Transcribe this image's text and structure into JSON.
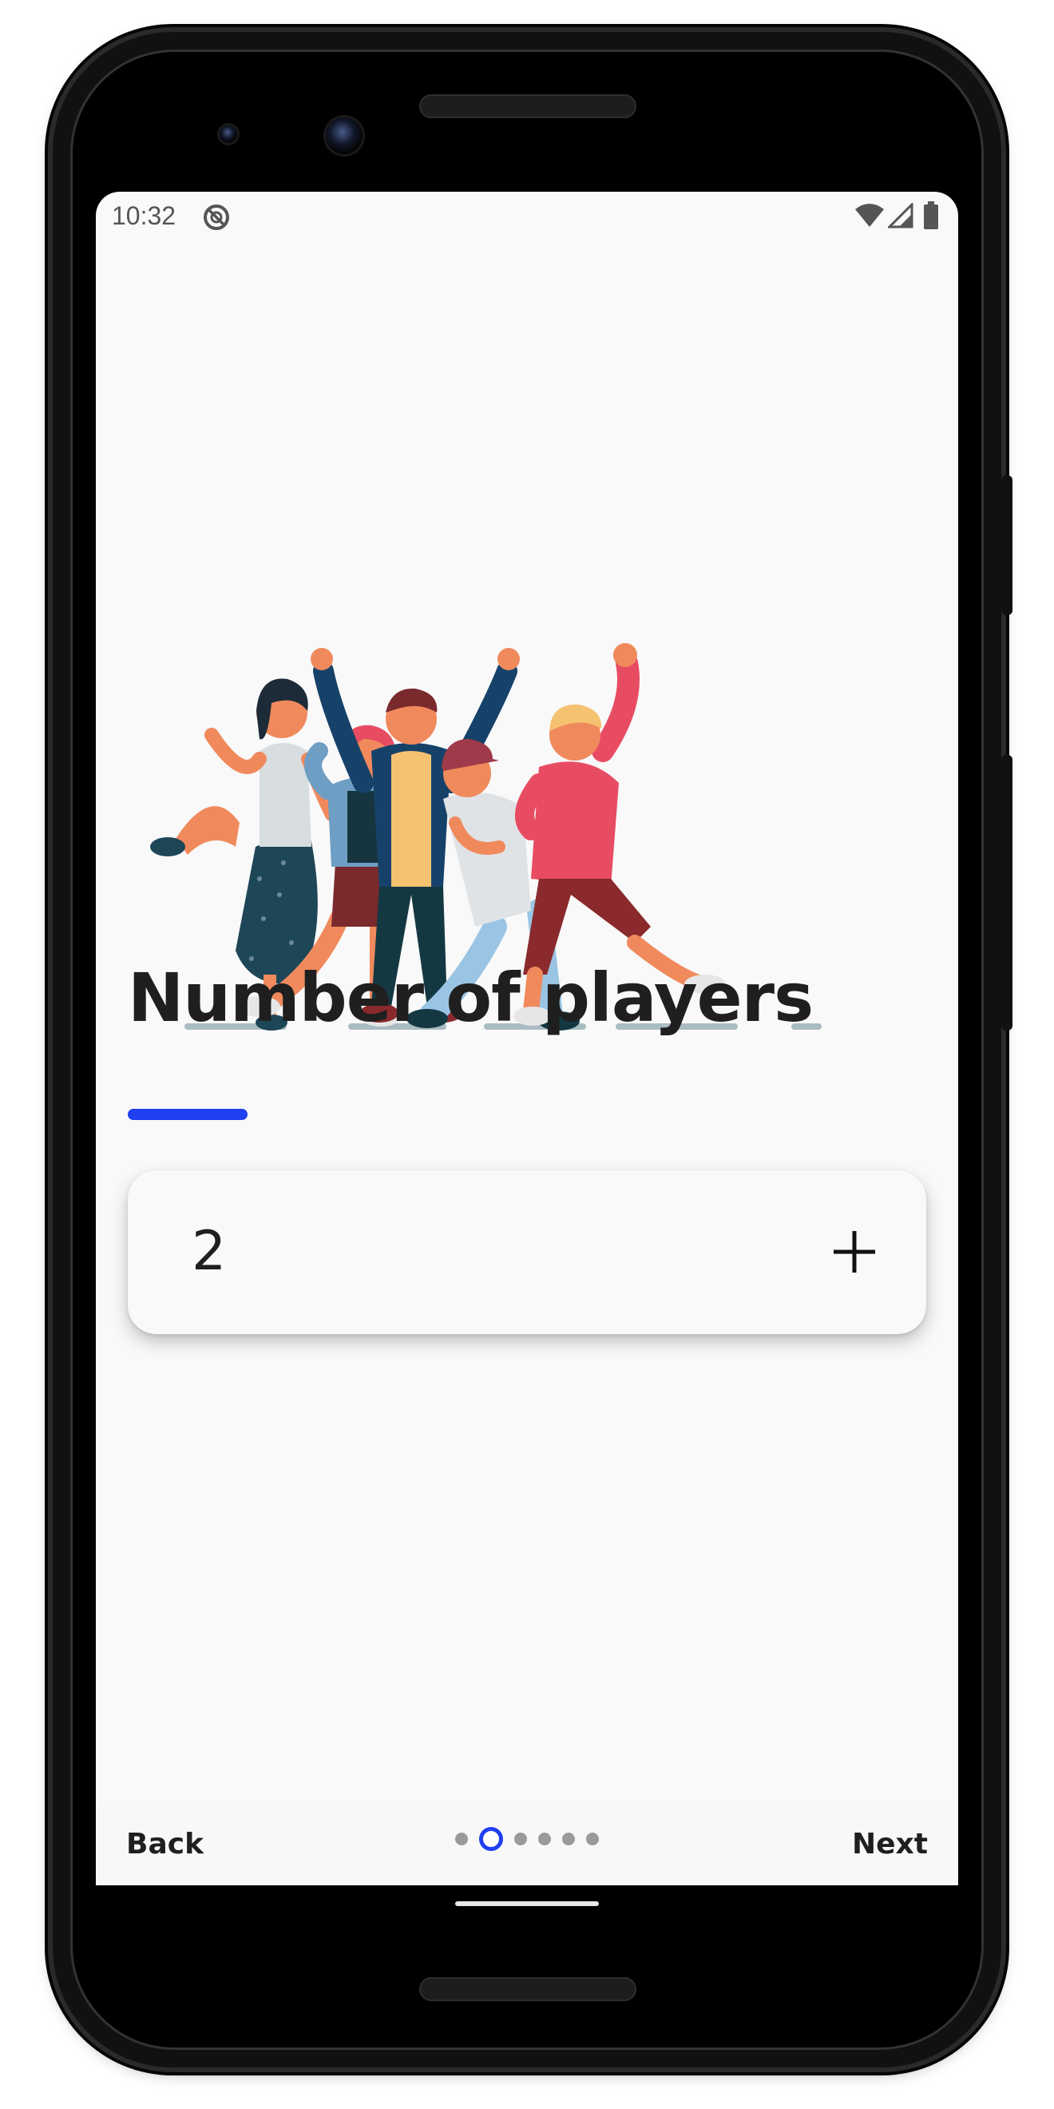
{
  "status_bar": {
    "time": "10:32",
    "icons": [
      "no-disturb-icon",
      "wifi-icon",
      "signal-icon",
      "battery-icon"
    ]
  },
  "screen": {
    "title": "Number of players",
    "accent_color": "#1f3ff0",
    "counter": {
      "value": "2",
      "increment_icon": "plus-icon"
    }
  },
  "navigation": {
    "back_label": "Back",
    "next_label": "Next",
    "page_count": 6,
    "current_page": 2
  },
  "colors": {
    "background": "#f9f9f9",
    "text": "#1f1f1f",
    "accent": "#1f3ff0"
  }
}
